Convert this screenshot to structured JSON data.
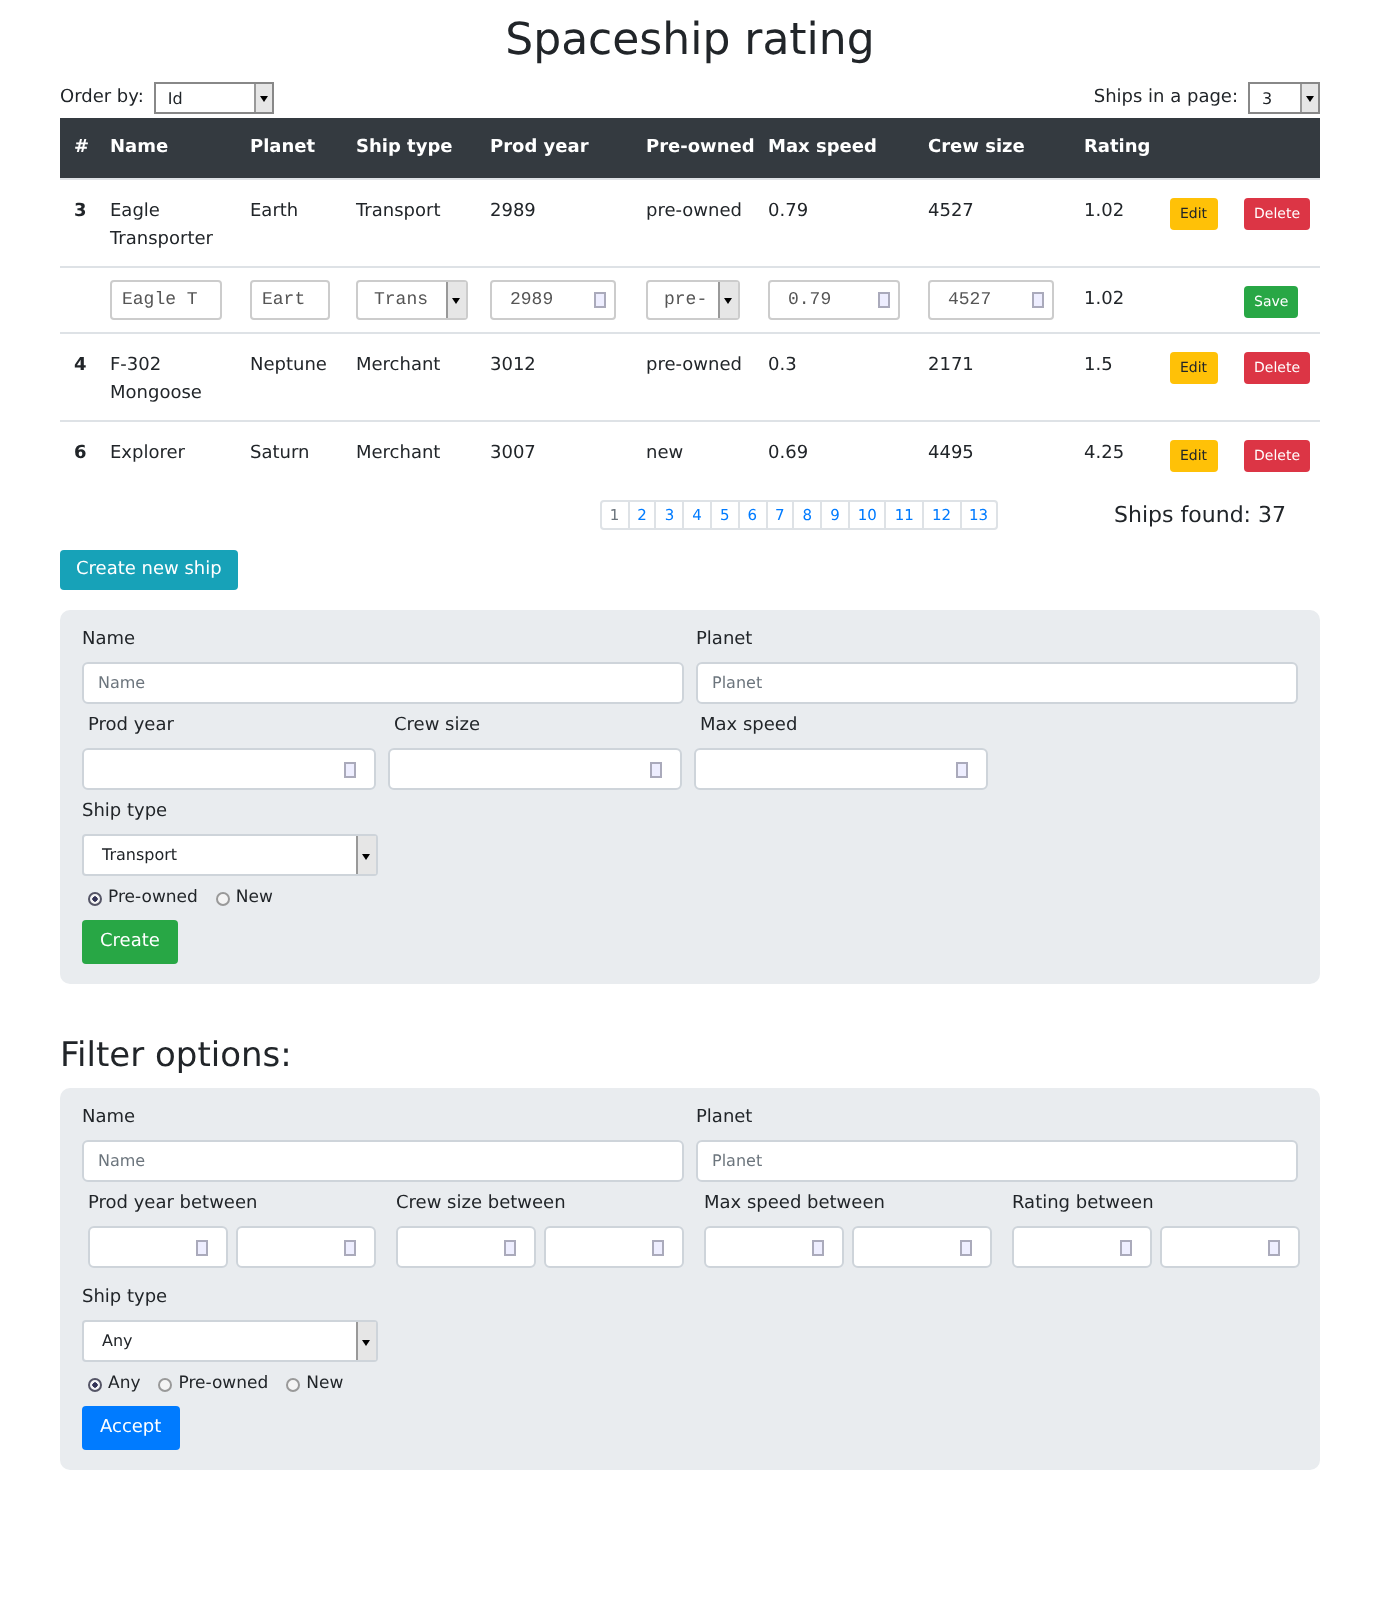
{
  "title": "Spaceship rating",
  "order_by": {
    "label": "Order by:",
    "value": "Id"
  },
  "page_size": {
    "label": "Ships in a page:",
    "value": "3"
  },
  "table": {
    "columns": [
      "#",
      "Name",
      "Planet",
      "Ship type",
      "Prod year",
      "Pre-owned",
      "Max speed",
      "Crew size",
      "Rating"
    ],
    "rows": [
      {
        "kind": "view",
        "cells": [
          "3",
          "Eagle Transporter",
          "Earth",
          "Transport",
          "2989",
          "pre-owned",
          "0.79",
          "4527",
          "1.02"
        ],
        "edit": "Edit",
        "delete": "Delete"
      },
      {
        "kind": "edit",
        "name": "Eagle T",
        "planet": "Eart",
        "ship_type": "Trans",
        "prod_year": "2989",
        "pre_owned": "pre-",
        "max_speed": "0.79",
        "crew_size": "4527",
        "rating": "1.02",
        "save": "Save"
      },
      {
        "kind": "view",
        "cells": [
          "4",
          "F-302 Mongoose",
          "Neptune",
          "Merchant",
          "3012",
          "pre-owned",
          "0.3",
          "2171",
          "1.5"
        ],
        "edit": "Edit",
        "delete": "Delete"
      },
      {
        "kind": "view",
        "cells": [
          "6",
          "Explorer",
          "Saturn",
          "Merchant",
          "3007",
          "new",
          "0.69",
          "4495",
          "4.25"
        ],
        "edit": "Edit",
        "delete": "Delete"
      }
    ]
  },
  "pagination": [
    {
      "label": "1",
      "selected": true
    },
    {
      "label": "2",
      "selected": false
    },
    {
      "label": "3",
      "selected": false
    },
    {
      "label": "4",
      "selected": false
    },
    {
      "label": "5",
      "selected": false
    },
    {
      "label": "6",
      "selected": false
    },
    {
      "label": "7",
      "selected": false
    },
    {
      "label": "8",
      "selected": false
    },
    {
      "label": "9",
      "selected": false
    },
    {
      "label": "10",
      "selected": false
    },
    {
      "label": "11",
      "selected": false
    },
    {
      "label": "12",
      "selected": false
    },
    {
      "label": "13",
      "selected": false
    }
  ],
  "ships_found": "Ships found: 37",
  "create_new_button": "Create new ship",
  "create_form": {
    "name_label": "Name",
    "name_placeholder": "Name",
    "planet_label": "Planet",
    "planet_placeholder": "Planet",
    "number_labels": [
      "Prod year",
      "Crew size",
      "Max speed"
    ],
    "ship_type_label": "Ship type",
    "ship_type_value": "Transport",
    "radios": [
      {
        "label": "Pre-owned",
        "selected": true
      },
      {
        "label": "New",
        "selected": false
      }
    ],
    "button": "Create"
  },
  "filter": {
    "heading": "Filter options:",
    "name_label": "Name",
    "name_placeholder": "Name",
    "planet_label": "Planet",
    "planet_placeholder": "Planet",
    "range_labels": [
      "Prod year between",
      "Crew size between",
      "Max speed between",
      "Rating between"
    ],
    "ship_type_label": "Ship type",
    "ship_type_value": "Any",
    "radios": [
      {
        "label": "Any",
        "selected": true
      },
      {
        "label": "Pre-owned",
        "selected": false
      },
      {
        "label": "New",
        "selected": false
      }
    ],
    "button": "Accept"
  }
}
